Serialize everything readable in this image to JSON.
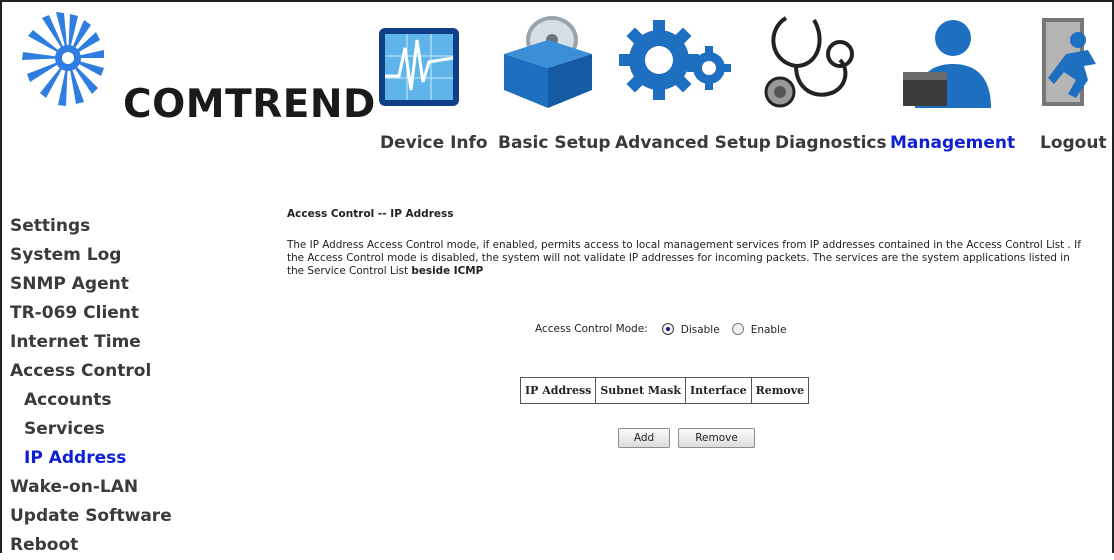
{
  "brand": {
    "name": "COMTREND"
  },
  "nav": {
    "items": [
      {
        "label": "Device Info",
        "icon": "device-info-icon"
      },
      {
        "label": "Basic Setup",
        "icon": "basic-setup-icon"
      },
      {
        "label": "Advanced Setup",
        "icon": "advanced-setup-icon"
      },
      {
        "label": "Diagnostics",
        "icon": "diagnostics-icon"
      },
      {
        "label": "Management",
        "icon": "management-icon",
        "active": true
      },
      {
        "label": "Logout",
        "icon": "logout-icon"
      }
    ]
  },
  "sidebar": {
    "items": [
      {
        "label": "Settings"
      },
      {
        "label": "System Log"
      },
      {
        "label": "SNMP Agent"
      },
      {
        "label": "TR-069 Client"
      },
      {
        "label": "Internet Time"
      },
      {
        "label": "Access Control"
      },
      {
        "label": "Accounts"
      },
      {
        "label": "Services"
      },
      {
        "label": "IP Address",
        "active": true
      },
      {
        "label": "Wake-on-LAN"
      },
      {
        "label": "Update Software"
      },
      {
        "label": "Reboot"
      }
    ]
  },
  "content": {
    "title": "Access Control -- IP Address",
    "description_1": "The IP Address Access Control mode, if enabled, permits access to local management services from IP addresses contained in the Access Control List . If the Access Control mode is disabled, the system will not validate IP addresses for incoming packets. The services are the system applications listed in the Service Control List",
    "description_bold": "beside ICMP",
    "mode_label": "Access Control Mode:",
    "mode_options": [
      {
        "label": "Disable",
        "selected": true
      },
      {
        "label": "Enable",
        "selected": false
      }
    ],
    "table_headers": [
      "IP Address",
      "Subnet Mask",
      "Interface",
      "Remove"
    ],
    "add_label": "Add",
    "remove_label": "Remove"
  },
  "colors": {
    "accent": "#0e1fd6",
    "nav_text": "#3a3a3a",
    "icon_blue": "#1f6fc1"
  }
}
